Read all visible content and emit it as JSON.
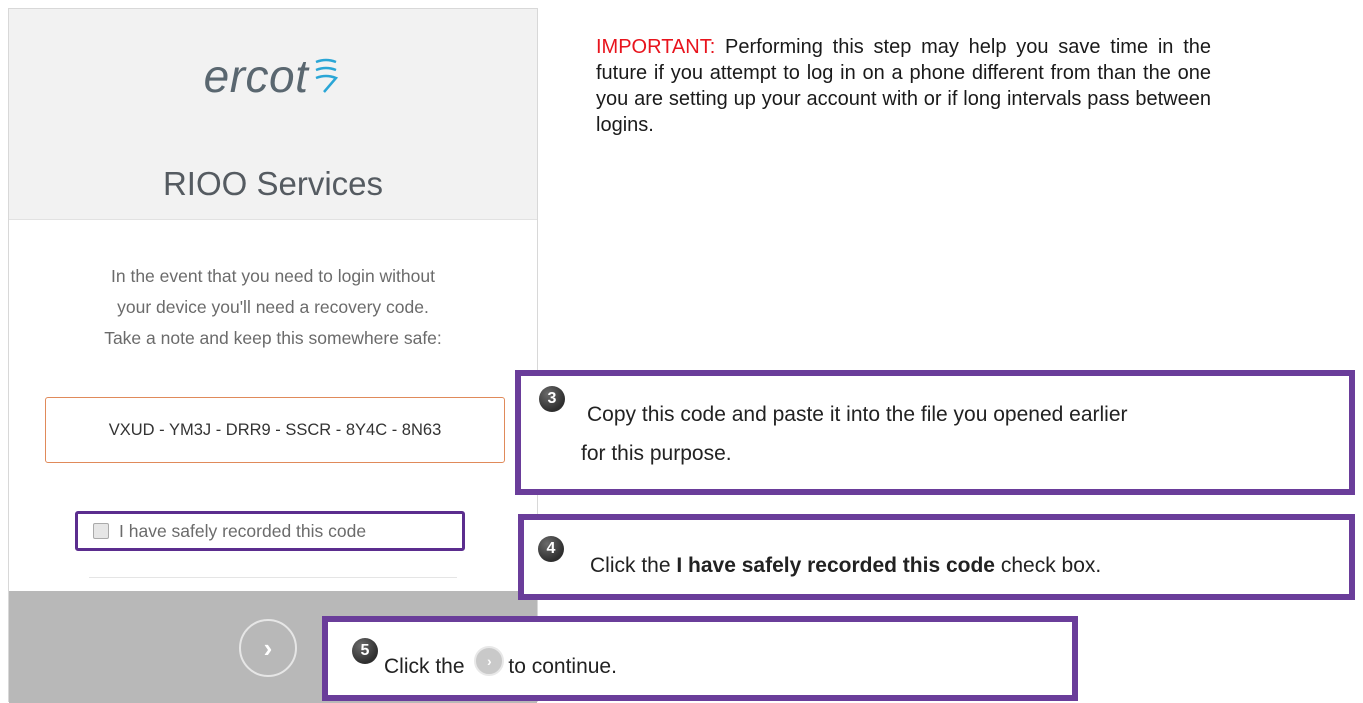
{
  "panel": {
    "logo_text": "ercot",
    "logo_icon": "ercot-wave-icon",
    "title": "RIOO Services",
    "instructions": [
      "In the event that you need to login without",
      "your device you'll need a recovery code.",
      "Take a note and keep this somewhere safe:"
    ],
    "recovery_code": "VXUD - YM3J - DRR9 - SSCR - 8Y4C - 8N63",
    "confirm_label": "I have safely recorded this code",
    "continue_icon": "chevron-right-icon",
    "continue_glyph": "›"
  },
  "notes": {
    "important_label": "IMPORTANT:",
    "important_text": " Performing this step may help you save time in the future if you attempt to log in on a phone different from than the one you are setting up your account with or if long intervals pass between logins."
  },
  "steps": [
    {
      "number": "3",
      "line1": "Copy this code and paste it into the file you opened earlier",
      "line2": "for this purpose."
    },
    {
      "number": "4",
      "pre": "Click the ",
      "bold": "I have safely recorded this code",
      "post": " check box."
    },
    {
      "number": "5",
      "pre": "Click the ",
      "post": "to continue."
    }
  ],
  "colors": {
    "highlight": "#6a3d9a",
    "important": "#e8141d",
    "code_border": "#e08a5a"
  }
}
